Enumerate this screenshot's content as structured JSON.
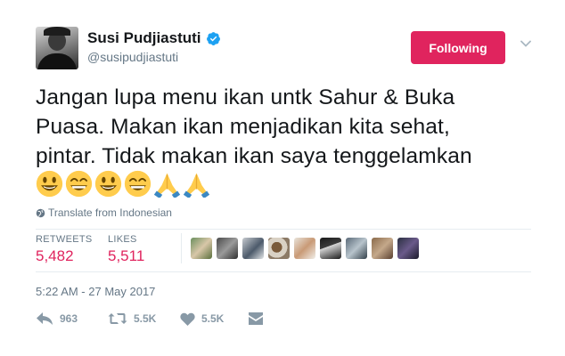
{
  "author": {
    "name": "Susi Pudjiastuti",
    "handle": "@susipudjiastuti",
    "verified_icon": "verified-badge-icon",
    "avatar": "profile-avatar"
  },
  "follow_button": {
    "label": "Following",
    "color": "#e0245e"
  },
  "caret": {
    "icon": "chevron-down-icon"
  },
  "tweet": {
    "lines": [
      "Jangan lupa menu ikan untk Sahur & Buka",
      "Puasa. Makan ikan menjadikan kita sehat,",
      "pintar. Tidak makan ikan saya tenggelamkan"
    ],
    "emojis": [
      "smiley-emoji",
      "grin-emoji",
      "smiley-emoji",
      "grin-emoji",
      "folded-hands-emoji",
      "folded-hands-emoji"
    ]
  },
  "translate": {
    "label": "Translate from Indonesian",
    "icon": "globe-icon"
  },
  "stats": {
    "retweets_label": "RETWEETS",
    "retweets_value": "5,482",
    "likes_label": "LIKES",
    "likes_value": "5,511",
    "value_color": "#e0245e"
  },
  "likers": {
    "count_shown": 9
  },
  "timestamp": "5:22 AM - 27 May 2017",
  "actions": {
    "reply_count": "963",
    "retweet_count": "5.5K",
    "like_count": "5.5K",
    "reply_icon": "reply-icon",
    "retweet_icon": "retweet-icon",
    "like_icon": "heart-icon",
    "dm_icon": "direct-message-icon"
  },
  "colors": {
    "text": "#14171a",
    "muted": "#657786",
    "icon": "#8899a6",
    "divider": "#e6ecf0",
    "verified": "#1da1f2"
  }
}
